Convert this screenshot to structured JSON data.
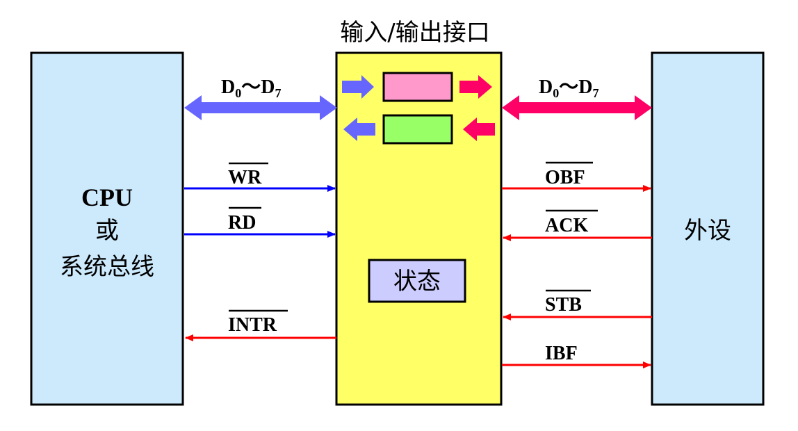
{
  "title": "输入/输出接口",
  "cpu_block": {
    "line1": "CPU",
    "line2": "或",
    "line3": "系统总线"
  },
  "peripheral_block": {
    "label": "外设"
  },
  "status_block": {
    "label": "状态"
  },
  "data_bus_left": {
    "d": "D",
    "sub0": "0",
    "tilde": "～",
    "sub7": "7"
  },
  "data_bus_right": {
    "d": "D",
    "sub0": "0",
    "tilde": "～",
    "sub7": "7"
  },
  "signals": {
    "wr": "WR",
    "rd": "RD",
    "intr": "INTR",
    "obf": "OBF",
    "ack": "ACK",
    "stb": "STB",
    "ibf": "IBF"
  },
  "colors": {
    "block_fill": "#cdeafd",
    "interface_fill": "#ffff66",
    "output_latch_fill": "#ff99cc",
    "input_latch_fill": "#99ff66",
    "status_fill": "#ccccff",
    "data_bus_left": "#6666ff",
    "data_bus_right": "#ff0066",
    "wr_rd_lines": "#0000ff",
    "control_lines": "#ff0000"
  }
}
